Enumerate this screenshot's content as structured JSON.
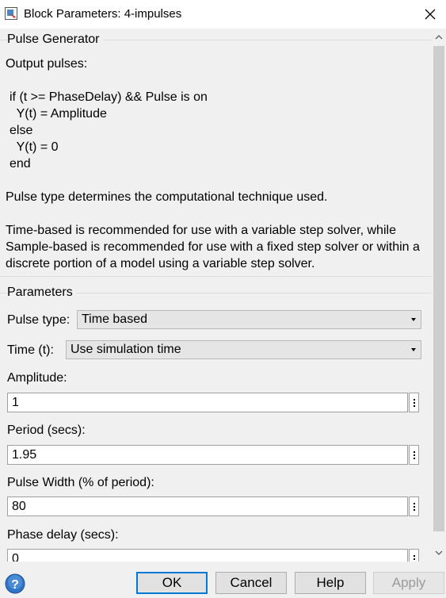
{
  "window": {
    "title": "Block Parameters: 4-impulses",
    "app_icon": "simulink-block-icon",
    "close_icon": "close-icon"
  },
  "description": {
    "section_title": "Pulse Generator",
    "intro": "Output pulses:",
    "code_lines": [
      "if (t >= PhaseDelay) && Pulse is on",
      "  Y(t) = Amplitude",
      "else",
      "  Y(t) = 0",
      "end"
    ],
    "pulse_type_note": "Pulse type determines the computational technique used.",
    "recommendation": "Time-based is recommended for use with a variable step solver, while Sample-based is recommended for use with a fixed step solver or within a discrete portion of a model using a variable step solver."
  },
  "parameters": {
    "section_title": "Parameters",
    "pulse_type": {
      "label": "Pulse type:",
      "value": "Time based"
    },
    "time": {
      "label": "Time (t):",
      "value": "Use simulation time"
    },
    "amplitude": {
      "label": "Amplitude:",
      "value": "1"
    },
    "period": {
      "label": "Period (secs):",
      "value": "1.95"
    },
    "pulse_width": {
      "label": "Pulse Width (% of period):",
      "value": "80"
    },
    "phase_delay": {
      "label": "Phase delay (secs):",
      "value": "0"
    }
  },
  "buttons": {
    "ok": "OK",
    "cancel": "Cancel",
    "help": "Help",
    "apply": "Apply"
  },
  "colors": {
    "default_button_border": "#0078d7",
    "help_icon": "#2f74c6"
  }
}
